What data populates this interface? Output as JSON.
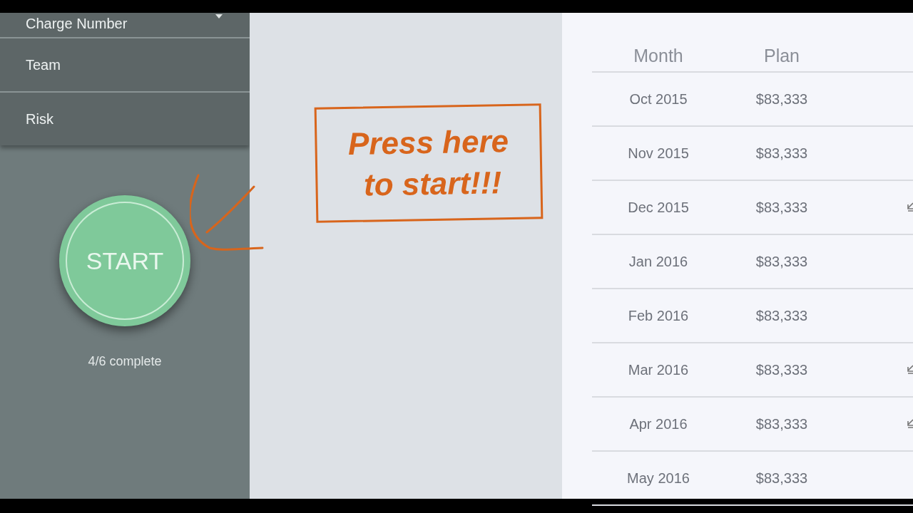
{
  "sidebar": {
    "items": [
      {
        "label": "Charge Number",
        "kind": "dropdown"
      },
      {
        "label": "Team",
        "kind": "plain"
      },
      {
        "label": "Risk",
        "kind": "plain"
      }
    ]
  },
  "start_button": {
    "label": "START"
  },
  "progress": "4/6 complete",
  "annotation": {
    "lines": [
      "Press here",
      "to start!!!"
    ]
  },
  "table": {
    "columns": [
      "Month",
      "Plan"
    ],
    "rows": [
      {
        "month": "Oct 2015",
        "plan": "$83,333",
        "flagged": false
      },
      {
        "month": "Nov 2015",
        "plan": "$83,333",
        "flagged": false
      },
      {
        "month": "Dec 2015",
        "plan": "$83,333",
        "flagged": true
      },
      {
        "month": "Jan 2016",
        "plan": "$83,333",
        "flagged": false
      },
      {
        "month": "Feb 2016",
        "plan": "$83,333",
        "flagged": false
      },
      {
        "month": "Mar 2016",
        "plan": "$83,333",
        "flagged": true
      },
      {
        "month": "Apr 2016",
        "plan": "$83,333",
        "flagged": true
      },
      {
        "month": "May 2016",
        "plan": "$83,333",
        "flagged": false
      }
    ]
  }
}
